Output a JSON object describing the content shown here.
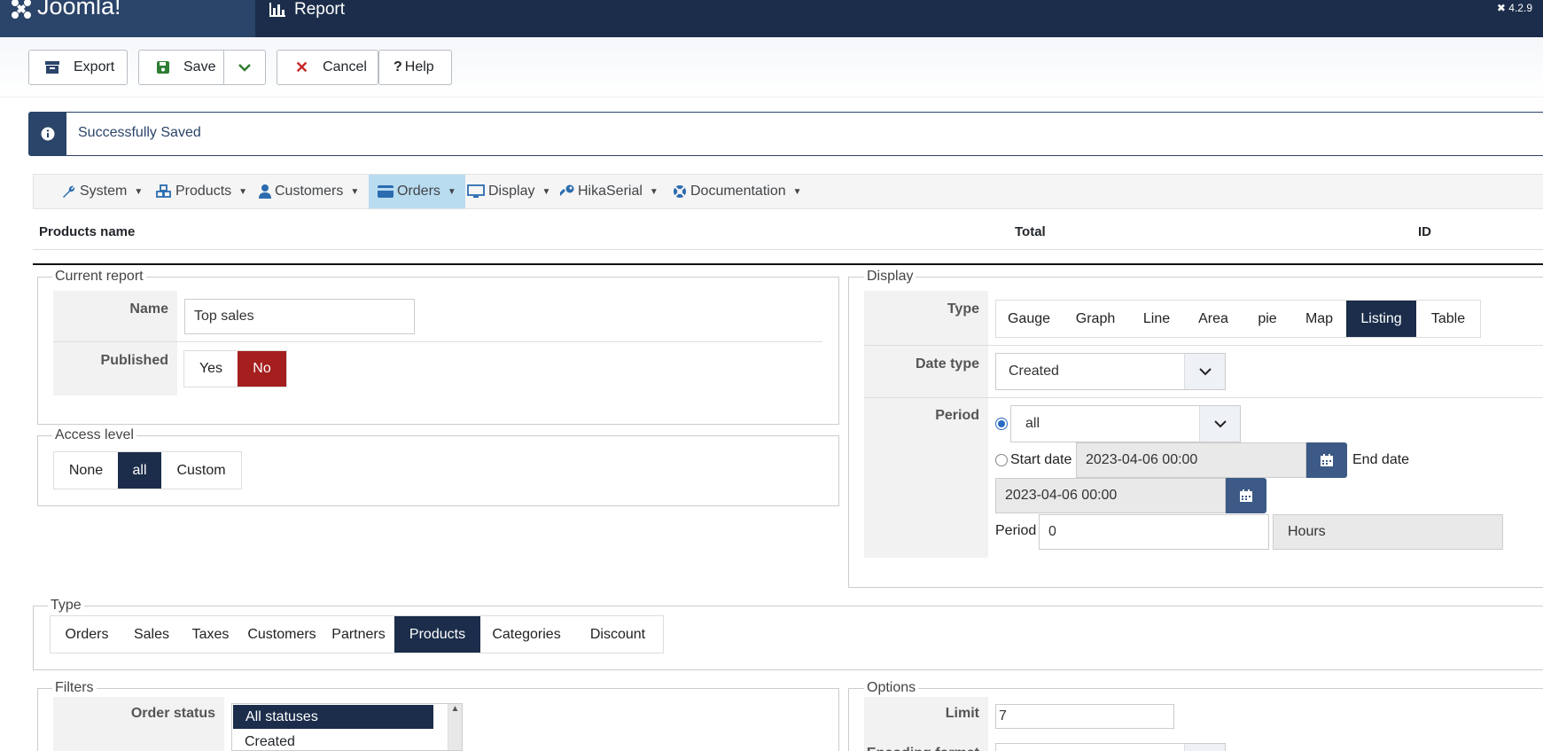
{
  "header": {
    "brand": "Joomla!",
    "title": "Report",
    "version": "4.2.9"
  },
  "toolbar": {
    "export": "Export",
    "save": "Save",
    "cancel": "Cancel",
    "help": "Help"
  },
  "alert": {
    "message": "Successfully Saved"
  },
  "menu": [
    {
      "label": "System",
      "icon": "wrench-icon"
    },
    {
      "label": "Products",
      "icon": "cubes-icon"
    },
    {
      "label": "Customers",
      "icon": "user-icon"
    },
    {
      "label": "Orders",
      "icon": "credit-card-icon"
    },
    {
      "label": "Display",
      "icon": "monitor-icon"
    },
    {
      "label": "HikaSerial",
      "icon": "key-icon"
    },
    {
      "label": "Documentation",
      "icon": "lifebuoy-icon"
    }
  ],
  "table": {
    "col_name": "Products name",
    "col_total": "Total",
    "col_id": "ID"
  },
  "current_report": {
    "legend": "Current report",
    "name_label": "Name",
    "name_value": "Top sales",
    "published_label": "Published",
    "yes": "Yes",
    "no": "No",
    "published": "No"
  },
  "access": {
    "legend": "Access level",
    "options": [
      "None",
      "all",
      "Custom"
    ],
    "selected": "all"
  },
  "display": {
    "legend": "Display",
    "type_label": "Type",
    "types": [
      "Gauge",
      "Graph",
      "Line",
      "Area",
      "pie",
      "Map",
      "Listing",
      "Table"
    ],
    "type_selected": "Listing",
    "date_type_label": "Date type",
    "date_type_value": "Created",
    "period_label": "Period",
    "period_value": "all",
    "start_date_label": "Start date",
    "start_date_value": "2023-04-06 00:00",
    "end_date_label": "End date",
    "end_date_value": "2023-04-06 00:00",
    "period2_label": "Period",
    "period2_value": "0",
    "period_unit": "Hours"
  },
  "type_section": {
    "legend": "Type",
    "options": [
      "Orders",
      "Sales",
      "Taxes",
      "Customers",
      "Partners",
      "Products",
      "Categories",
      "Discount"
    ],
    "selected": "Products"
  },
  "filters": {
    "legend": "Filters",
    "order_status_label": "Order status",
    "statuses": [
      "All statuses",
      "Created"
    ]
  },
  "options": {
    "legend": "Options",
    "limit_label": "Limit",
    "limit_value": "7",
    "encoding_label": "Encoding format"
  }
}
